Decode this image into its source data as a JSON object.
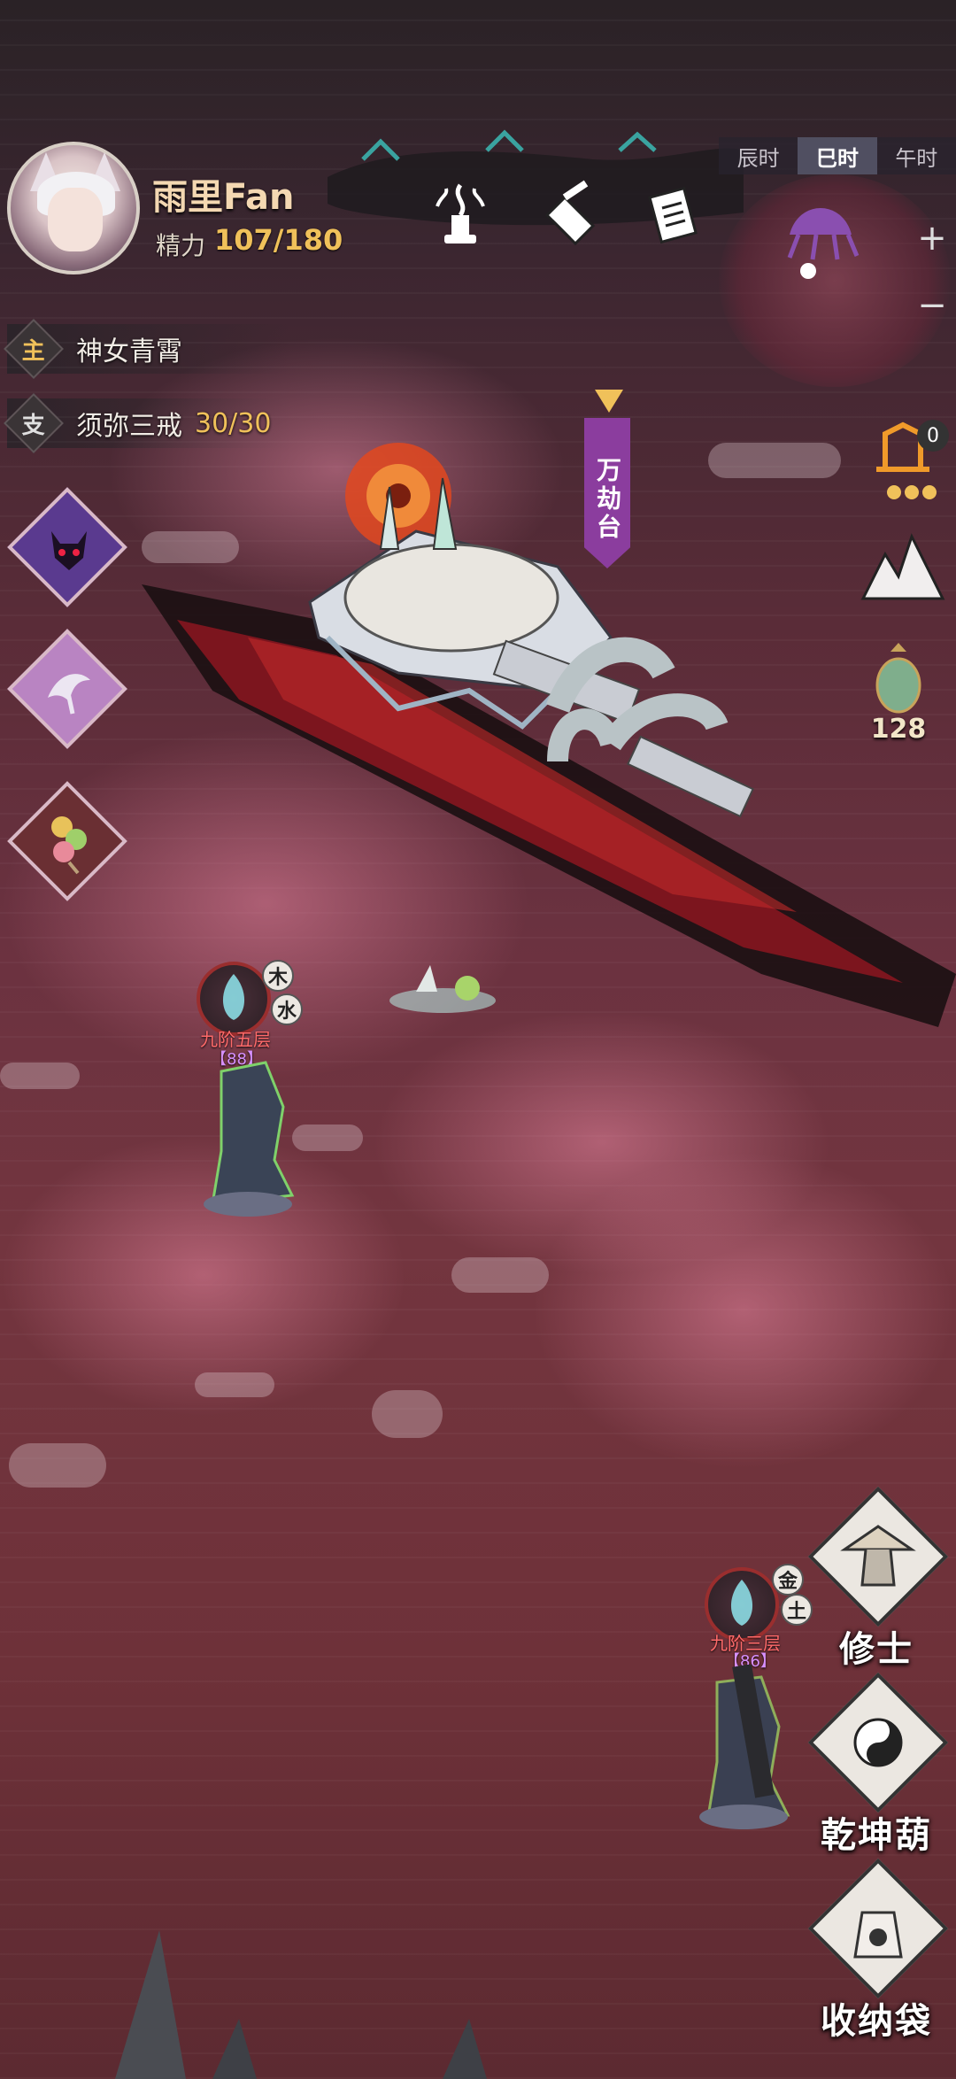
{
  "player": {
    "name": "雨里Fan",
    "energy_label": "精力",
    "energy_value": "107/180"
  },
  "time_tabs": [
    "辰时",
    "巳时",
    "午时"
  ],
  "active_time_tab": "巳时",
  "zoom": {
    "in": "+",
    "out": "−"
  },
  "quests": {
    "main": {
      "tag": "主",
      "title": "神女青霄"
    },
    "side": {
      "tag": "支",
      "title": "须弥三戒",
      "progress": "30/30"
    }
  },
  "location_marker": "万劫台",
  "right_tools": {
    "lantern_badge": "0",
    "gourd_count": "128"
  },
  "npcs": [
    {
      "rank": "九阶五层",
      "level": "【88】",
      "elements": [
        "木",
        "水"
      ]
    },
    {
      "rank": "九阶三层",
      "level": "【86】",
      "elements": [
        "金",
        "土"
      ]
    }
  ],
  "menu": {
    "cultivator": "修士",
    "gourd": "乾坤葫",
    "bag": "收纳袋"
  },
  "colors": {
    "accent_gold": "#f0c15a",
    "marker_purple": "#8b3d9e",
    "enemy_rank_red": "#ff6a6a"
  }
}
